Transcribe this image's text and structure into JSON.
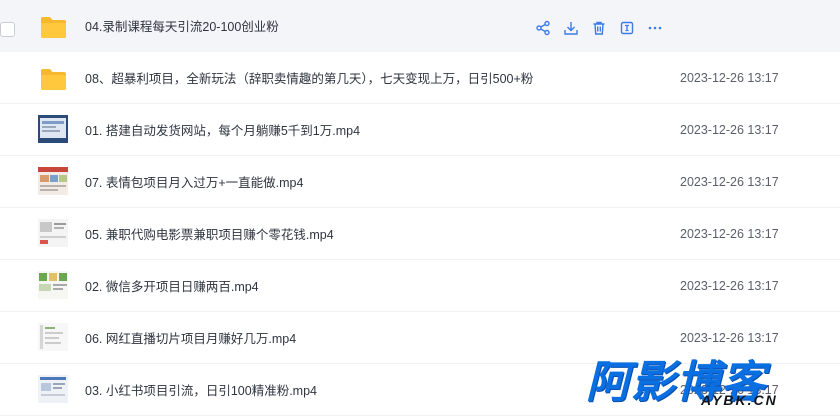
{
  "files": [
    {
      "name": "04.录制课程每天引流20-100创业粉",
      "date": "",
      "type": "folder",
      "hovered": true
    },
    {
      "name": "08、超暴利项目，全新玩法（辞职卖情趣的第几天），七天变现上万，日引500+粉",
      "date": "2023-12-26 13:17",
      "type": "folder"
    },
    {
      "name": "01. 搭建自动发货网站，每个月躺赚5千到1万.mp4",
      "date": "2023-12-26 13:17",
      "type": "video"
    },
    {
      "name": "07. 表情包项目月入过万+一直能做.mp4",
      "date": "2023-12-26 13:17",
      "type": "video"
    },
    {
      "name": "05. 兼职代购电影票兼职项目赚个零花钱.mp4",
      "date": "2023-12-26 13:17",
      "type": "video"
    },
    {
      "name": "02. 微信多开项目日赚两百.mp4",
      "date": "2023-12-26 13:17",
      "type": "video"
    },
    {
      "name": "06. 网红直播切片项目月赚好几万.mp4",
      "date": "2023-12-26 13:17",
      "type": "video"
    },
    {
      "name": "03. 小红书项目引流，日引100精准粉.mp4",
      "date": "2023-12-26 13:17",
      "type": "video"
    }
  ],
  "row_actions": [
    "share-icon",
    "download-icon",
    "delete-icon",
    "rename-icon",
    "more-icon"
  ],
  "watermark": {
    "title": "阿影博客",
    "domain": "AYBK.CN"
  },
  "colors": {
    "accent": "#0a6fe0",
    "folder": "#f5b82e",
    "action": "#3d7be6"
  }
}
